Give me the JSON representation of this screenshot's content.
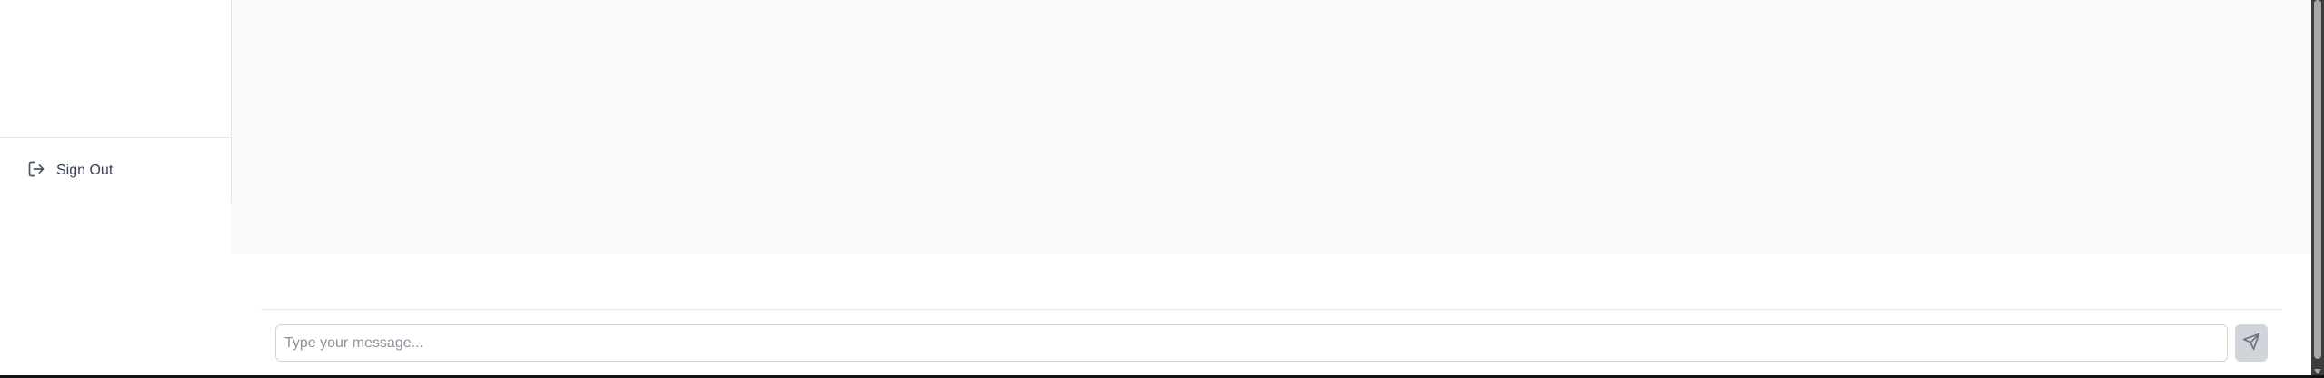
{
  "sidebar": {
    "sign_out_label": "Sign Out"
  },
  "composer": {
    "placeholder": "Type your message...",
    "value": ""
  }
}
